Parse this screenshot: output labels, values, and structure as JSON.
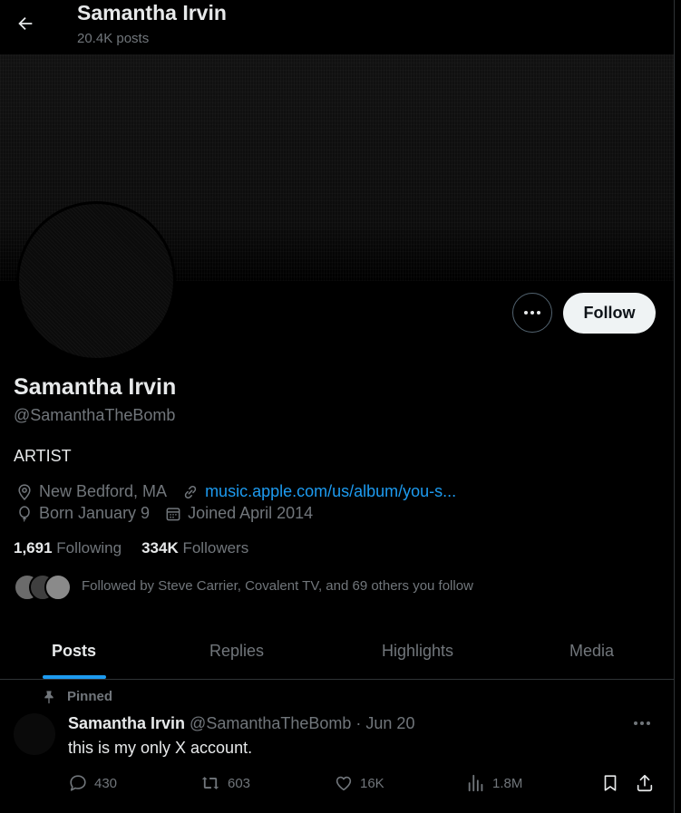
{
  "header": {
    "name": "Samantha Irvin",
    "posts_count": "20.4K posts"
  },
  "profile": {
    "name": "Samantha Irvin",
    "handle": "@SamanthaTheBomb",
    "bio": "ARTIST",
    "location": "New Bedford, MA",
    "website": "music.apple.com/us/album/you-s...",
    "birthday": "Born January 9",
    "joined": "Joined April 2014",
    "following_count": "1,691",
    "following_label": "Following",
    "followers_count": "334K",
    "followers_label": "Followers",
    "followed_by": "Followed by Steve Carrier, Covalent TV, and 69 others you follow",
    "follow_label": "Follow"
  },
  "tabs": [
    {
      "label": "Posts",
      "active": true
    },
    {
      "label": "Replies",
      "active": false
    },
    {
      "label": "Highlights",
      "active": false
    },
    {
      "label": "Media",
      "active": false
    }
  ],
  "post": {
    "pinned_label": "Pinned",
    "author_name": "Samantha Irvin",
    "author_handle_time": "@SamanthaTheBomb · Jun 20",
    "text": "this is my only X account.",
    "replies": "430",
    "reposts": "603",
    "likes": "16K",
    "views": "1.8M"
  },
  "colors": {
    "accent": "#1d9bf0",
    "muted": "#71767b",
    "text": "#e7e9ea",
    "background": "#000000"
  }
}
